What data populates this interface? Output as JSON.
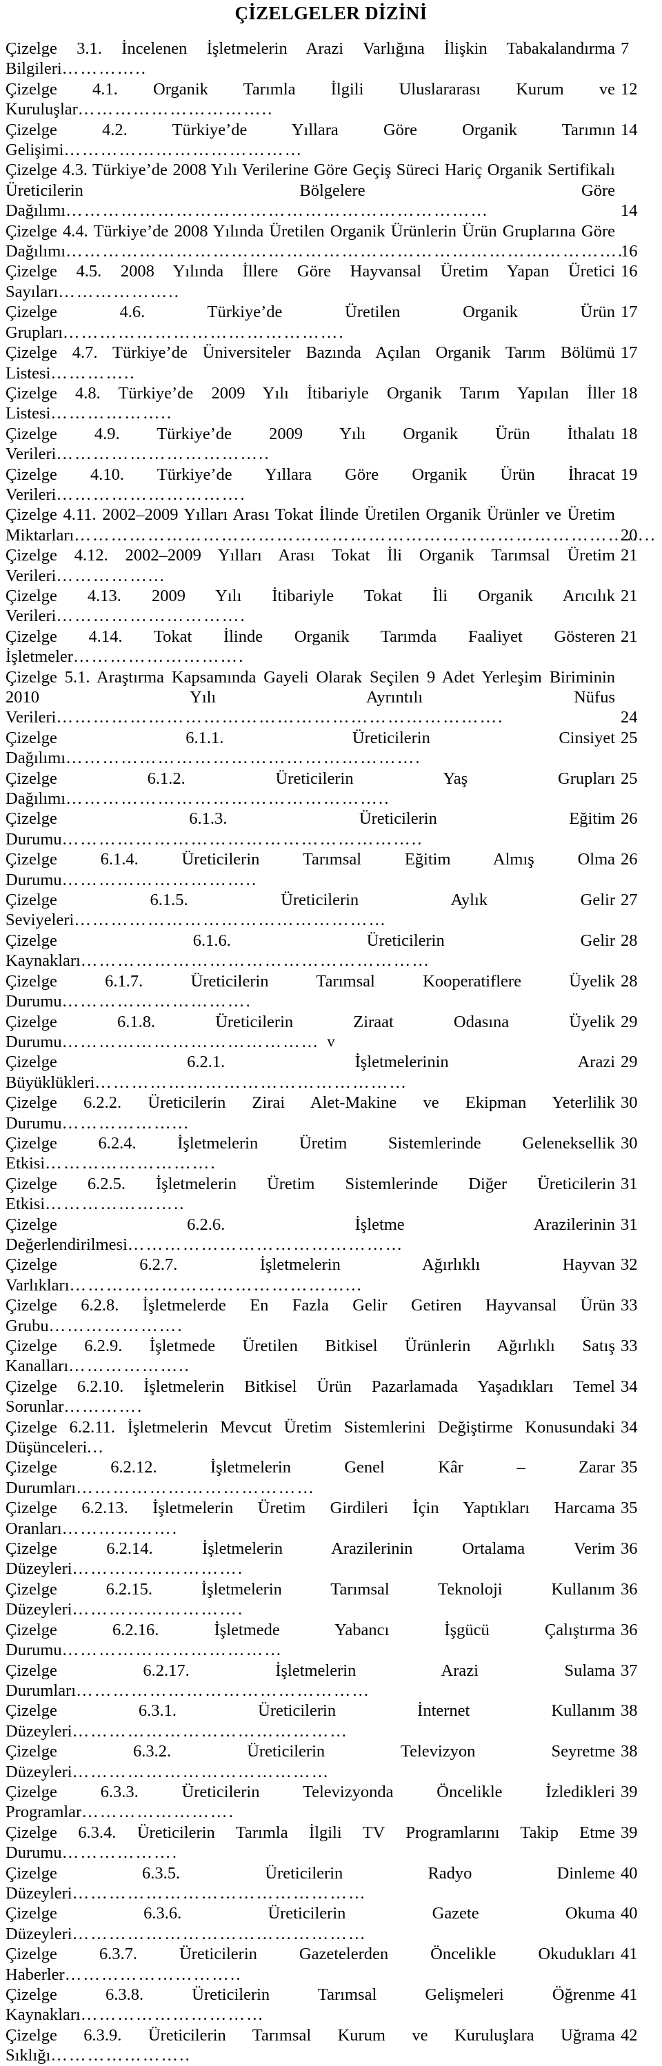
{
  "page": {
    "title": "ÇİZELGELER DİZİNİ",
    "folio": "v",
    "language": "tr"
  },
  "toc": {
    "entries": [
      {
        "id": "3.1",
        "label": "Çizelge 3.1. İncelenen İşletmelerin Arazi Varlığına İlişkin Tabakalandırma Bilgileri",
        "leader": "…………..",
        "page": "7",
        "lines": 1
      },
      {
        "id": "4.1",
        "label": "Çizelge 4.1. Organik Tarımla İlgili Uluslararası Kurum ve Kuruluşlar",
        "leader": "…………………………..",
        "page": "12",
        "lines": 1
      },
      {
        "id": "4.2",
        "label": "Çizelge 4.2. Türkiye’de Yıllara Göre Organik Tarımın Gelişimi",
        "leader": "…………………………………",
        "page": "14",
        "lines": 1
      },
      {
        "id": "4.3",
        "label": "Çizelge 4.3. Türkiye’de 2008 Yılı Verilerine Göre Geçiş Süreci Hariç Organik Sertifikalı Üreticilerin Bölgelere Göre Dağılımı",
        "leader": "……………………………………………………………",
        "page": "14",
        "lines": 2
      },
      {
        "id": "4.4",
        "label": "Çizelge 4.4. Türkiye’de 2008 Yılında Üretilen Organik Ürünlerin Ürün Gruplarına Göre Dağılımı",
        "leader": "……………………………………………………………………………….",
        "page": "16",
        "lines": 2
      },
      {
        "id": "4.5",
        "label": "Çizelge 4.5. 2008 Yılında İllere Göre Hayvansal Üretim Yapan Üretici Sayıları",
        "leader": "………………..",
        "page": "16",
        "lines": 1
      },
      {
        "id": "4.6",
        "label": "Çizelge 4.6. Türkiye’de Üretilen Organik Ürün Grupları",
        "leader": "……………………………………….",
        "page": "17",
        "lines": 1
      },
      {
        "id": "4.7",
        "label": "Çizelge 4.7. Türkiye’de Üniversiteler Bazında Açılan Organik Tarım Bölümü Listesi",
        "leader": "…………..",
        "page": "17",
        "lines": 1
      },
      {
        "id": "4.8",
        "label": "Çizelge 4.8. Türkiye’de 2009 Yılı İtibariyle Organik Tarım Yapılan İller Listesi",
        "leader": "………………..",
        "page": "18",
        "lines": 1
      },
      {
        "id": "4.9",
        "label": "Çizelge 4.9. Türkiye’de 2009 Yılı Organik Ürün İthalatı Verileri",
        "leader": "……………………………..",
        "page": "18",
        "lines": 1
      },
      {
        "id": "4.10",
        "label": "Çizelge 4.10. Türkiye’de Yıllara Göre Organik Ürün İhracat Verileri",
        "leader": "………………………….",
        "page": "19",
        "lines": 1
      },
      {
        "id": "4.11",
        "label": "Çizelge 4.11. 2002–2009 Yılları Arası Tokat İlinde Üretilen Organik Ürünler ve Üretim Miktarları",
        "leader": "…………………………………………………………………………………..",
        "page": "20",
        "lines": 2
      },
      {
        "id": "4.12",
        "label": "Çizelge 4.12. 2002–2009 Yılları Arası Tokat İli Organik Tarımsal Üretim Verileri",
        "leader": "……………...",
        "page": "21",
        "lines": 1
      },
      {
        "id": "4.13",
        "label": "Çizelge 4.13. 2009 Yılı İtibariyle Tokat İli Organik Arıcılık Verileri",
        "leader": "………………………….",
        "page": "21",
        "lines": 1
      },
      {
        "id": "4.14",
        "label": "Çizelge 4.14. Tokat İlinde Organik Tarımda Faaliyet Gösteren İşletmeler",
        "leader": "……………………….",
        "page": "21",
        "lines": 1
      },
      {
        "id": "5.1",
        "label": "Çizelge 5.1. Araştırma Kapsamında Gayeli Olarak Seçilen 9 Adet Yerleşim Biriminin 2010 Yılı Ayrıntılı Nüfus Verileri",
        "leader": "……………………………………………………………….",
        "page": "24",
        "lines": 2
      },
      {
        "id": "6.1.1",
        "label": "Çizelge 6.1.1. Üreticilerin Cinsiyet Dağılımı",
        "leader": "………………………………………………….",
        "page": "25",
        "lines": 1
      },
      {
        "id": "6.1.2",
        "label": "Çizelge 6.1.2. Üreticilerin Yaş Grupları Dağılımı",
        "leader": "……………………………………………..",
        "page": "25",
        "lines": 1
      },
      {
        "id": "6.1.3",
        "label": "Çizelge 6.1.3. Üreticilerin Eğitim Durumu",
        "leader": "…………………………………………………..",
        "page": "26",
        "lines": 1
      },
      {
        "id": "6.1.4",
        "label": "Çizelge 6.1.4. Üreticilerin Tarımsal Eğitim Almış Olma Durumu",
        "leader": "…………………………..",
        "page": "26",
        "lines": 1
      },
      {
        "id": "6.1.5",
        "label": "Çizelge 6.1.5. Üreticilerin Aylık Gelir Seviyeleri",
        "leader": "……………………………………………",
        "page": "27",
        "lines": 1
      },
      {
        "id": "6.1.6",
        "label": "Çizelge 6.1.6. Üreticilerin Gelir Kaynakları",
        "leader": "…………………………………………………",
        "page": "28",
        "lines": 1
      },
      {
        "id": "6.1.7",
        "label": "Çizelge 6.1.7. Üreticilerin Tarımsal Kooperatiflere Üyelik Durumu",
        "leader": "………………………….",
        "page": "28",
        "lines": 1
      },
      {
        "id": "6.1.8",
        "label": "Çizelge 6.1.8. Üreticilerin Ziraat Odasına Üyelik Durumu",
        "leader": "……………………………………",
        "page": "29",
        "lines": 1
      },
      {
        "id": "6.2.1",
        "label": "Çizelge 6.2.1. İşletmelerinin Arazi Büyüklükleri",
        "leader": "……………………………………………",
        "page": "29",
        "lines": 1
      },
      {
        "id": "6.2.2",
        "label": "Çizelge 6.2.2. Üreticilerin Zirai Alet-Makine ve Ekipman Yeterlilik Durumu",
        "leader": "………………...",
        "page": "30",
        "lines": 1
      },
      {
        "id": "6.2.4",
        "label": "Çizelge 6.2.4. İşletmelerin Üretim Sistemlerinde Geleneksellik Etkisi",
        "leader": "……………………….",
        "page": "30",
        "lines": 1
      },
      {
        "id": "6.2.5",
        "label": "Çizelge 6.2.5. İşletmelerin Üretim Sistemlerinde Diğer Üreticilerin Etkisi",
        "leader": "…………………..",
        "page": "31",
        "lines": 1
      },
      {
        "id": "6.2.6",
        "label": "Çizelge 6.2.6. İşletme Arazilerinin Değerlendirilmesi",
        "leader": "………………………………………",
        "page": "31",
        "lines": 1
      },
      {
        "id": "6.2.7",
        "label": "Çizelge 6.2.7. İşletmelerin Ağırlıklı Hayvan Varlıkları",
        "leader": "………………………………………...",
        "page": "32",
        "lines": 1
      },
      {
        "id": "6.2.8",
        "label": "Çizelge 6.2.8. İşletmelerde En Fazla Gelir Getiren Hayvansal Ürün Grubu",
        "leader": "………………….",
        "page": "33",
        "lines": 1
      },
      {
        "id": "6.2.9",
        "label": "Çizelge 6.2.9. İşletmede Üretilen Bitkisel Ürünlerin Ağırlıklı Satış Kanalları",
        "leader": "………………..",
        "page": "33",
        "lines": 1
      },
      {
        "id": "6.2.10",
        "label": "Çizelge 6.2.10. İşletmelerin Bitkisel Ürün Pazarlamada Yaşadıkları Temel Sorunlar",
        "leader": "………….",
        "page": "34",
        "lines": 1
      },
      {
        "id": "6.2.11",
        "label": "Çizelge 6.2.11. İşletmelerin Mevcut Üretim Sistemlerini Değiştirme Konusundaki Düşünceleri",
        "leader": "...",
        "page": "34",
        "lines": 1
      },
      {
        "id": "6.2.12",
        "label": "Çizelge 6.2.12. İşletmelerin Genel Kâr – Zarar Durumları",
        "leader": "…………………………………",
        "page": "35",
        "lines": 1
      },
      {
        "id": "6.2.13",
        "label": "Çizelge 6.2.13. İşletmelerin Üretim Girdileri İçin Yaptıkları Harcama Oranları",
        "leader": "……………….",
        "page": "35",
        "lines": 1
      },
      {
        "id": "6.2.14",
        "label": "Çizelge 6.2.14. İşletmelerin Arazilerinin Ortalama Verim Düzeyleri",
        "leader": "……………………….",
        "page": "36",
        "lines": 1
      },
      {
        "id": "6.2.15",
        "label": "Çizelge 6.2.15. İşletmelerin Tarımsal Teknoloji Kullanım Düzeyleri",
        "leader": "……………………….",
        "page": "36",
        "lines": 1
      },
      {
        "id": "6.2.16",
        "label": "Çizelge 6.2.16. İşletmede Yabancı İşgücü Çalıştırma Durumu",
        "leader": "………………………………",
        "page": "36",
        "lines": 1
      },
      {
        "id": "6.2.17",
        "label": "Çizelge 6.2.17. İşletmelerin Arazi Sulama Durumları",
        "leader": "…………………………………………",
        "page": "37",
        "lines": 1
      },
      {
        "id": "6.3.1",
        "label": "Çizelge 6.3.1. Üreticilerin İnternet Kullanım Düzeyleri",
        "leader": "………………………………………",
        "page": "38",
        "lines": 1
      },
      {
        "id": "6.3.2",
        "label": "Çizelge 6.3.2. Üreticilerin Televizyon Seyretme Düzeyleri",
        "leader": "……………………………………",
        "page": "38",
        "lines": 1
      },
      {
        "id": "6.3.3",
        "label": "Çizelge 6.3.3. Üreticilerin Televizyonda Öncelikle İzledikleri Programlar",
        "leader": "…………………….",
        "page": "39",
        "lines": 1
      },
      {
        "id": "6.3.4",
        "label": "Çizelge 6.3.4. Üreticilerin Tarımla İlgili TV Programlarını Takip Etme Durumu",
        "leader": "……………….",
        "page": "39",
        "lines": 1
      },
      {
        "id": "6.3.5",
        "label": "Çizelge 6.3.5. Üreticilerin Radyo Dinleme Düzeyleri",
        "leader": "…………………………………………",
        "page": "40",
        "lines": 1
      },
      {
        "id": "6.3.6",
        "label": "Çizelge 6.3.6. Üreticilerin Gazete Okuma Düzeyleri",
        "leader": "…………………………………………",
        "page": "40",
        "lines": 1
      },
      {
        "id": "6.3.7",
        "label": "Çizelge 6.3.7. Üreticilerin Gazetelerden Öncelikle Okudukları Haberler",
        "leader": "………………………..",
        "page": "41",
        "lines": 1
      },
      {
        "id": "6.3.8",
        "label": "Çizelge 6.3.8. Üreticilerin Tarımsal Gelişmeleri Öğrenme Kaynakları",
        "leader": "…………………………",
        "page": "41",
        "lines": 1
      },
      {
        "id": "6.3.9",
        "label": "Çizelge 6.3.9. Üreticilerin Tarımsal Kurum ve Kuruluşlara Uğrama Sıklığı",
        "leader": "…………………..",
        "page": "42",
        "lines": 1
      }
    ]
  }
}
